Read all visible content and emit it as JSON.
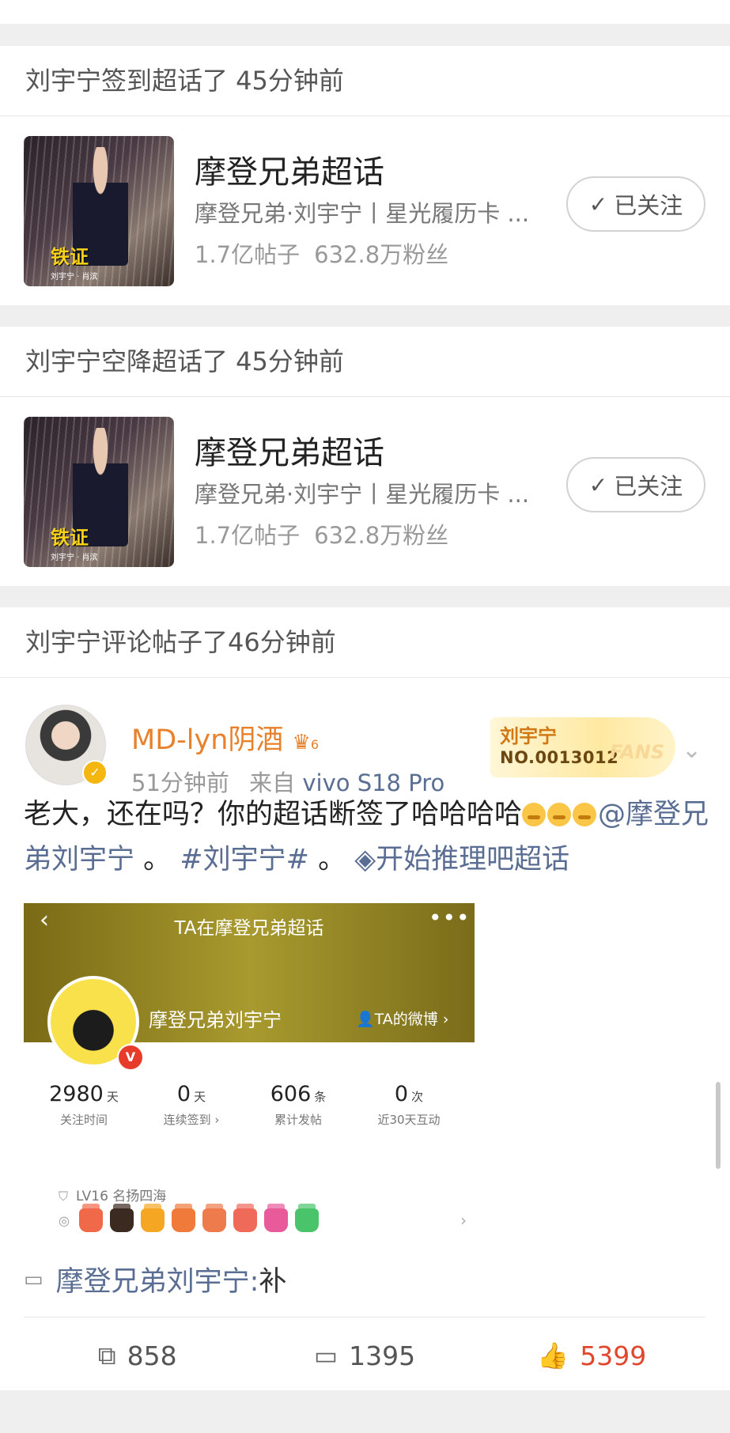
{
  "activities": [
    {
      "header": "刘宇宁签到超话了 45分钟前",
      "topic": {
        "name": "摩登兄弟超话",
        "desc": "摩登兄弟·刘宇宁丨星光履历卡 ...",
        "posts": "1.7亿帖子",
        "fans": "632.8万粉丝",
        "thumb_text": "铁证",
        "thumb_sub": "刘宇宁 · 肖滨",
        "follow_label": "已关注",
        "follow_icon": "✓"
      }
    },
    {
      "header": "刘宇宁空降超话了 45分钟前",
      "topic": {
        "name": "摩登兄弟超话",
        "desc": "摩登兄弟·刘宇宁丨星光履历卡 ...",
        "posts": "1.7亿帖子",
        "fans": "632.8万粉丝",
        "thumb_text": "铁证",
        "thumb_sub": "刘宇宁 · 肖滨",
        "follow_label": "已关注",
        "follow_icon": "✓"
      }
    }
  ],
  "comment_activity": {
    "header": "刘宇宁评论帖子了46分钟前",
    "post": {
      "username": "MD-lyn阴酒",
      "crown_level": "6",
      "time": "51分钟前",
      "source_prefix": "来自",
      "device": "vivo S18 Pro",
      "fans_badge": {
        "name": "刘宇宁",
        "number": "NO.0013012",
        "word": "FANS"
      },
      "text_main": "老大，还在吗？你的超话断签了哈哈哈哈",
      "text_at": "@摩登兄弟刘宇宁",
      "text_sep1": " 。",
      "text_hashtag": "#刘宇宁#",
      "text_sep2": " 。",
      "text_topic_icon": "◈",
      "text_topic": "开始推理吧超话",
      "screenshot": {
        "back": "‹",
        "title": "TA在摩登兄弟超话",
        "more": "•••",
        "name": "摩登兄弟刘宇宁",
        "weibo_link": "TA的微博 ›",
        "stats": [
          {
            "num": "2980",
            "unit": "天",
            "label": "关注时间"
          },
          {
            "num": "0",
            "unit": "天",
            "label": "连续签到 ›"
          },
          {
            "num": "606",
            "unit": "条",
            "label": "累计发帖"
          },
          {
            "num": "0",
            "unit": "次",
            "label": "近30天互动"
          }
        ],
        "level": "LV16 名扬四海",
        "badge_colors": [
          "#f06a4a",
          "#3a2a20",
          "#f5a623",
          "#f07a3a",
          "#ee7b4b",
          "#f06a5a",
          "#e85a9a",
          "#4ac46a"
        ]
      },
      "comment_author": "摩登兄弟刘宇宁:",
      "comment_text": " 补",
      "actions": {
        "repost": "858",
        "comments": "1395",
        "likes": "5399"
      }
    }
  }
}
